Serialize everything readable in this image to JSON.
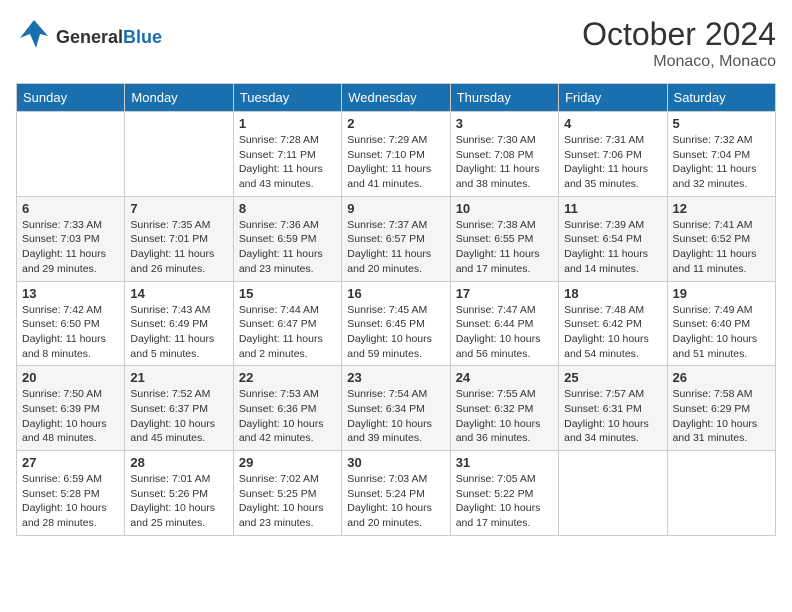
{
  "header": {
    "logo_general": "General",
    "logo_blue": "Blue",
    "month": "October 2024",
    "location": "Monaco, Monaco"
  },
  "weekdays": [
    "Sunday",
    "Monday",
    "Tuesday",
    "Wednesday",
    "Thursday",
    "Friday",
    "Saturday"
  ],
  "weeks": [
    [
      {
        "day": "",
        "info": ""
      },
      {
        "day": "",
        "info": ""
      },
      {
        "day": "1",
        "info": "Sunrise: 7:28 AM\nSunset: 7:11 PM\nDaylight: 11 hours and 43 minutes."
      },
      {
        "day": "2",
        "info": "Sunrise: 7:29 AM\nSunset: 7:10 PM\nDaylight: 11 hours and 41 minutes."
      },
      {
        "day": "3",
        "info": "Sunrise: 7:30 AM\nSunset: 7:08 PM\nDaylight: 11 hours and 38 minutes."
      },
      {
        "day": "4",
        "info": "Sunrise: 7:31 AM\nSunset: 7:06 PM\nDaylight: 11 hours and 35 minutes."
      },
      {
        "day": "5",
        "info": "Sunrise: 7:32 AM\nSunset: 7:04 PM\nDaylight: 11 hours and 32 minutes."
      }
    ],
    [
      {
        "day": "6",
        "info": "Sunrise: 7:33 AM\nSunset: 7:03 PM\nDaylight: 11 hours and 29 minutes."
      },
      {
        "day": "7",
        "info": "Sunrise: 7:35 AM\nSunset: 7:01 PM\nDaylight: 11 hours and 26 minutes."
      },
      {
        "day": "8",
        "info": "Sunrise: 7:36 AM\nSunset: 6:59 PM\nDaylight: 11 hours and 23 minutes."
      },
      {
        "day": "9",
        "info": "Sunrise: 7:37 AM\nSunset: 6:57 PM\nDaylight: 11 hours and 20 minutes."
      },
      {
        "day": "10",
        "info": "Sunrise: 7:38 AM\nSunset: 6:55 PM\nDaylight: 11 hours and 17 minutes."
      },
      {
        "day": "11",
        "info": "Sunrise: 7:39 AM\nSunset: 6:54 PM\nDaylight: 11 hours and 14 minutes."
      },
      {
        "day": "12",
        "info": "Sunrise: 7:41 AM\nSunset: 6:52 PM\nDaylight: 11 hours and 11 minutes."
      }
    ],
    [
      {
        "day": "13",
        "info": "Sunrise: 7:42 AM\nSunset: 6:50 PM\nDaylight: 11 hours and 8 minutes."
      },
      {
        "day": "14",
        "info": "Sunrise: 7:43 AM\nSunset: 6:49 PM\nDaylight: 11 hours and 5 minutes."
      },
      {
        "day": "15",
        "info": "Sunrise: 7:44 AM\nSunset: 6:47 PM\nDaylight: 11 hours and 2 minutes."
      },
      {
        "day": "16",
        "info": "Sunrise: 7:45 AM\nSunset: 6:45 PM\nDaylight: 10 hours and 59 minutes."
      },
      {
        "day": "17",
        "info": "Sunrise: 7:47 AM\nSunset: 6:44 PM\nDaylight: 10 hours and 56 minutes."
      },
      {
        "day": "18",
        "info": "Sunrise: 7:48 AM\nSunset: 6:42 PM\nDaylight: 10 hours and 54 minutes."
      },
      {
        "day": "19",
        "info": "Sunrise: 7:49 AM\nSunset: 6:40 PM\nDaylight: 10 hours and 51 minutes."
      }
    ],
    [
      {
        "day": "20",
        "info": "Sunrise: 7:50 AM\nSunset: 6:39 PM\nDaylight: 10 hours and 48 minutes."
      },
      {
        "day": "21",
        "info": "Sunrise: 7:52 AM\nSunset: 6:37 PM\nDaylight: 10 hours and 45 minutes."
      },
      {
        "day": "22",
        "info": "Sunrise: 7:53 AM\nSunset: 6:36 PM\nDaylight: 10 hours and 42 minutes."
      },
      {
        "day": "23",
        "info": "Sunrise: 7:54 AM\nSunset: 6:34 PM\nDaylight: 10 hours and 39 minutes."
      },
      {
        "day": "24",
        "info": "Sunrise: 7:55 AM\nSunset: 6:32 PM\nDaylight: 10 hours and 36 minutes."
      },
      {
        "day": "25",
        "info": "Sunrise: 7:57 AM\nSunset: 6:31 PM\nDaylight: 10 hours and 34 minutes."
      },
      {
        "day": "26",
        "info": "Sunrise: 7:58 AM\nSunset: 6:29 PM\nDaylight: 10 hours and 31 minutes."
      }
    ],
    [
      {
        "day": "27",
        "info": "Sunrise: 6:59 AM\nSunset: 5:28 PM\nDaylight: 10 hours and 28 minutes."
      },
      {
        "day": "28",
        "info": "Sunrise: 7:01 AM\nSunset: 5:26 PM\nDaylight: 10 hours and 25 minutes."
      },
      {
        "day": "29",
        "info": "Sunrise: 7:02 AM\nSunset: 5:25 PM\nDaylight: 10 hours and 23 minutes."
      },
      {
        "day": "30",
        "info": "Sunrise: 7:03 AM\nSunset: 5:24 PM\nDaylight: 10 hours and 20 minutes."
      },
      {
        "day": "31",
        "info": "Sunrise: 7:05 AM\nSunset: 5:22 PM\nDaylight: 10 hours and 17 minutes."
      },
      {
        "day": "",
        "info": ""
      },
      {
        "day": "",
        "info": ""
      }
    ]
  ]
}
